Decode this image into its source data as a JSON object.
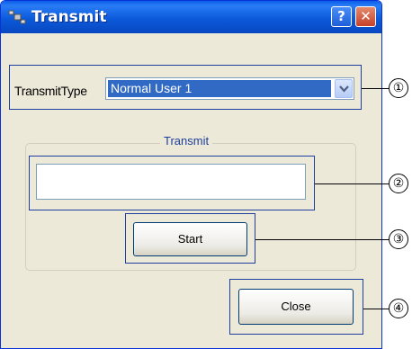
{
  "window": {
    "title": "Transmit",
    "help_glyph": "?",
    "close_glyph": "✕"
  },
  "transmit_type": {
    "label": "TransmitType",
    "selected": "Normal User 1"
  },
  "group": {
    "title": "Transmit",
    "input_value": "",
    "start_label": "Start"
  },
  "close_label": "Close",
  "callouts": [
    "①",
    "②",
    "③",
    "④"
  ],
  "colors": {
    "titlebar": "#0b5adb",
    "highlight": "#1f3f9f",
    "selection": "#316ac5",
    "face": "#ece9d8"
  }
}
